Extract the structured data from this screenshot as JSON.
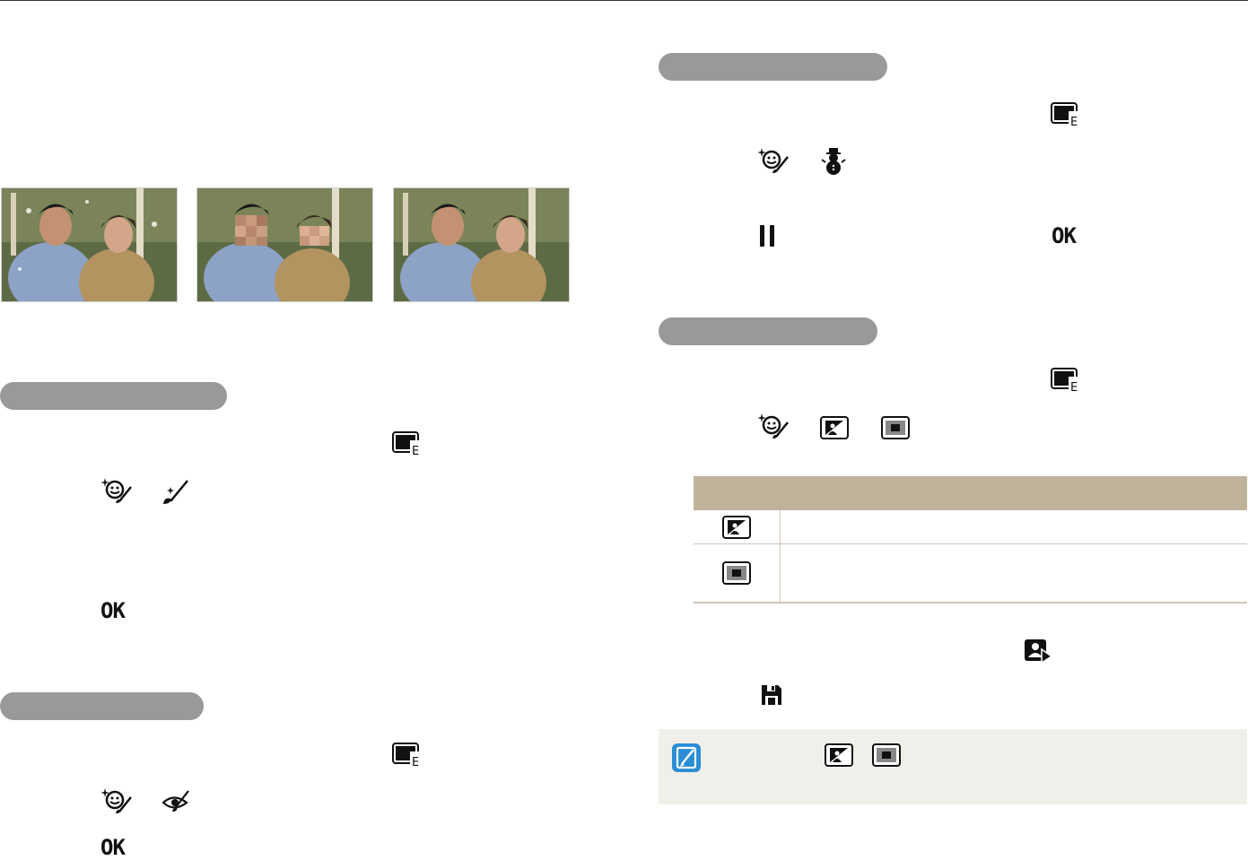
{
  "page": {
    "sections": [
      {
        "id": "s1",
        "heading": ""
      },
      {
        "id": "s2",
        "heading": ""
      },
      {
        "id": "s3",
        "heading": ""
      },
      {
        "id": "s4",
        "heading": ""
      }
    ]
  },
  "icons": {
    "edit": "photo-edit-icon",
    "face_retouch": "face-retouch-icon",
    "brush": "brush-icon",
    "eye": "red-eye-icon",
    "snowman": "snowman-icon",
    "pause": "pause-icon",
    "ok": "ok-button-icon",
    "backlight": "backlight-icon",
    "center": "center-frame-icon",
    "play_person": "person-play-icon",
    "save": "save-icon",
    "note": "note-icon"
  },
  "labels": {
    "ok": "OK"
  },
  "colors": {
    "pill": "#999999",
    "table_header": "#bfb39c",
    "note_bg": "#f1efea",
    "note_badge": "#2a8ed4"
  },
  "table": {
    "headers": [
      "",
      ""
    ],
    "rows": [
      {
        "icon": "backlight-icon",
        "text": ""
      },
      {
        "icon": "center-frame-icon",
        "text": ""
      }
    ]
  }
}
